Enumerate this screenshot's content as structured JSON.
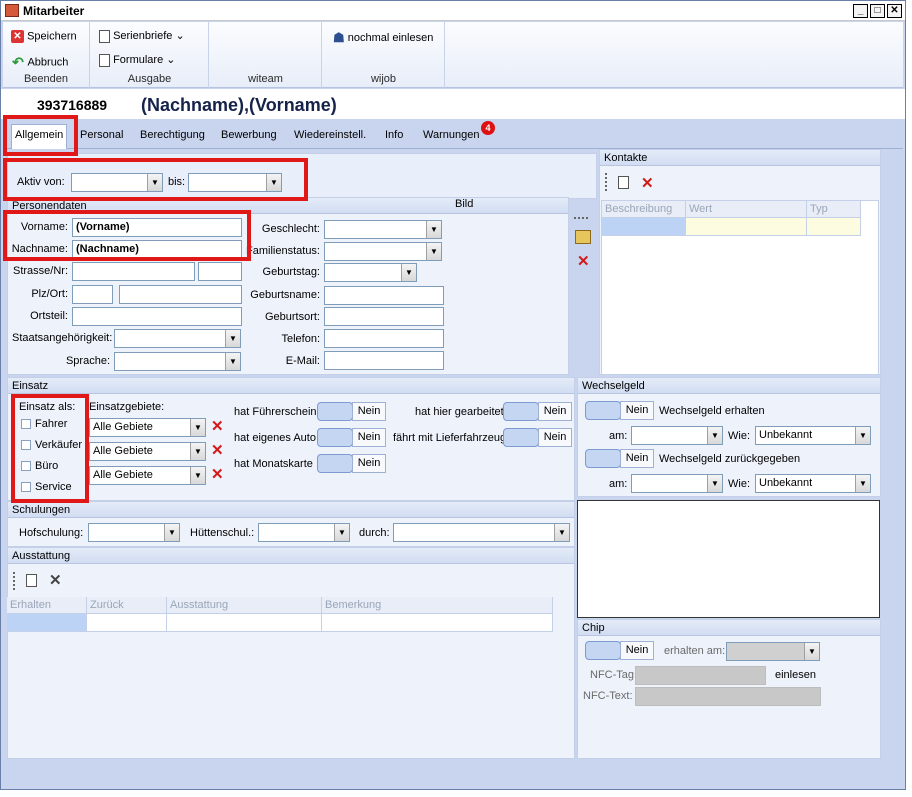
{
  "window": {
    "title": "Mitarbeiter"
  },
  "ribbon": {
    "speichern": "Speichern",
    "abbruch": "Abbruch",
    "grp_beenden": "Beenden",
    "serienbriefe": "Serienbriefe",
    "formulare": "Formulare",
    "grp_ausgabe": "Ausgabe",
    "grp_witeam": "witeam",
    "nochmal": "nochmal einlesen",
    "grp_wijob": "wijob"
  },
  "header": {
    "number": "393716889",
    "name": "(Nachname),(Vorname)"
  },
  "tabs": [
    "Allgemein",
    "Personal",
    "Berechtigung",
    "Bewerbung",
    "Wiedereinstell.",
    "Info",
    "Warnungen"
  ],
  "warn_count": "4",
  "aktiv": {
    "von_label": "Aktiv von:",
    "bis_label": "bis:"
  },
  "personendaten": {
    "title": "Personendaten",
    "bild": "Bild",
    "vorname_label": "Vorname:",
    "vorname": "(Vorname)",
    "nachname_label": "Nachname:",
    "nachname": "(Nachname)",
    "strasse_label": "Strasse/Nr:",
    "plz_label": "Plz/Ort:",
    "ortsteil_label": "Ortsteil:",
    "staat_label": "Staatsangehörigkeit:",
    "sprache_label": "Sprache:",
    "geschlecht_label": "Geschlecht:",
    "familien_label": "Familienstatus:",
    "geburtstag_label": "Geburtstag:",
    "geburtsname_label": "Geburtsname:",
    "geburtsort_label": "Geburtsort:",
    "telefon_label": "Telefon:",
    "email_label": "E-Mail:"
  },
  "kontakte": {
    "title": "Kontakte",
    "cols": [
      "Beschreibung",
      "Wert",
      "Typ"
    ]
  },
  "einsatz": {
    "title": "Einsatz",
    "als_label": "Einsatz als:",
    "als": [
      "Fahrer",
      "Verkäufer",
      "Büro",
      "Service"
    ],
    "gebiete_label": "Einsatzgebiete:",
    "gebiete": [
      "Alle Gebiete",
      "Alle Gebiete",
      "Alle Gebiete"
    ],
    "fuehrerschein": "hat Führerschein",
    "auto": "hat eigenes Auto",
    "monatskarte": "hat Monatskarte",
    "gearbeitet": "hat hier gearbeitet",
    "lieferfahrzeug": "fährt mit Lieferfahrzeug",
    "nein": "Nein"
  },
  "wechselgeld": {
    "title": "Wechselgeld",
    "erhalten": "Wechselgeld erhalten",
    "zurueck": "Wechselgeld zurückgegeben",
    "am": "am:",
    "wie": "Wie:",
    "unbekannt": "Unbekannt",
    "nein": "Nein"
  },
  "schulungen": {
    "title": "Schulungen",
    "hof": "Hofschulung:",
    "huetten": "Hüttenschul.:",
    "durch": "durch:"
  },
  "ausstattung": {
    "title": "Ausstattung",
    "cols": [
      "Erhalten",
      "Zurück",
      "Ausstattung",
      "Bemerkung"
    ]
  },
  "chip": {
    "title": "Chip",
    "nein": "Nein",
    "erhalten": "erhalten am:",
    "nfc_tag": "NFC-Tag",
    "nfc_text": "NFC-Text:",
    "einlesen": "einlesen"
  }
}
